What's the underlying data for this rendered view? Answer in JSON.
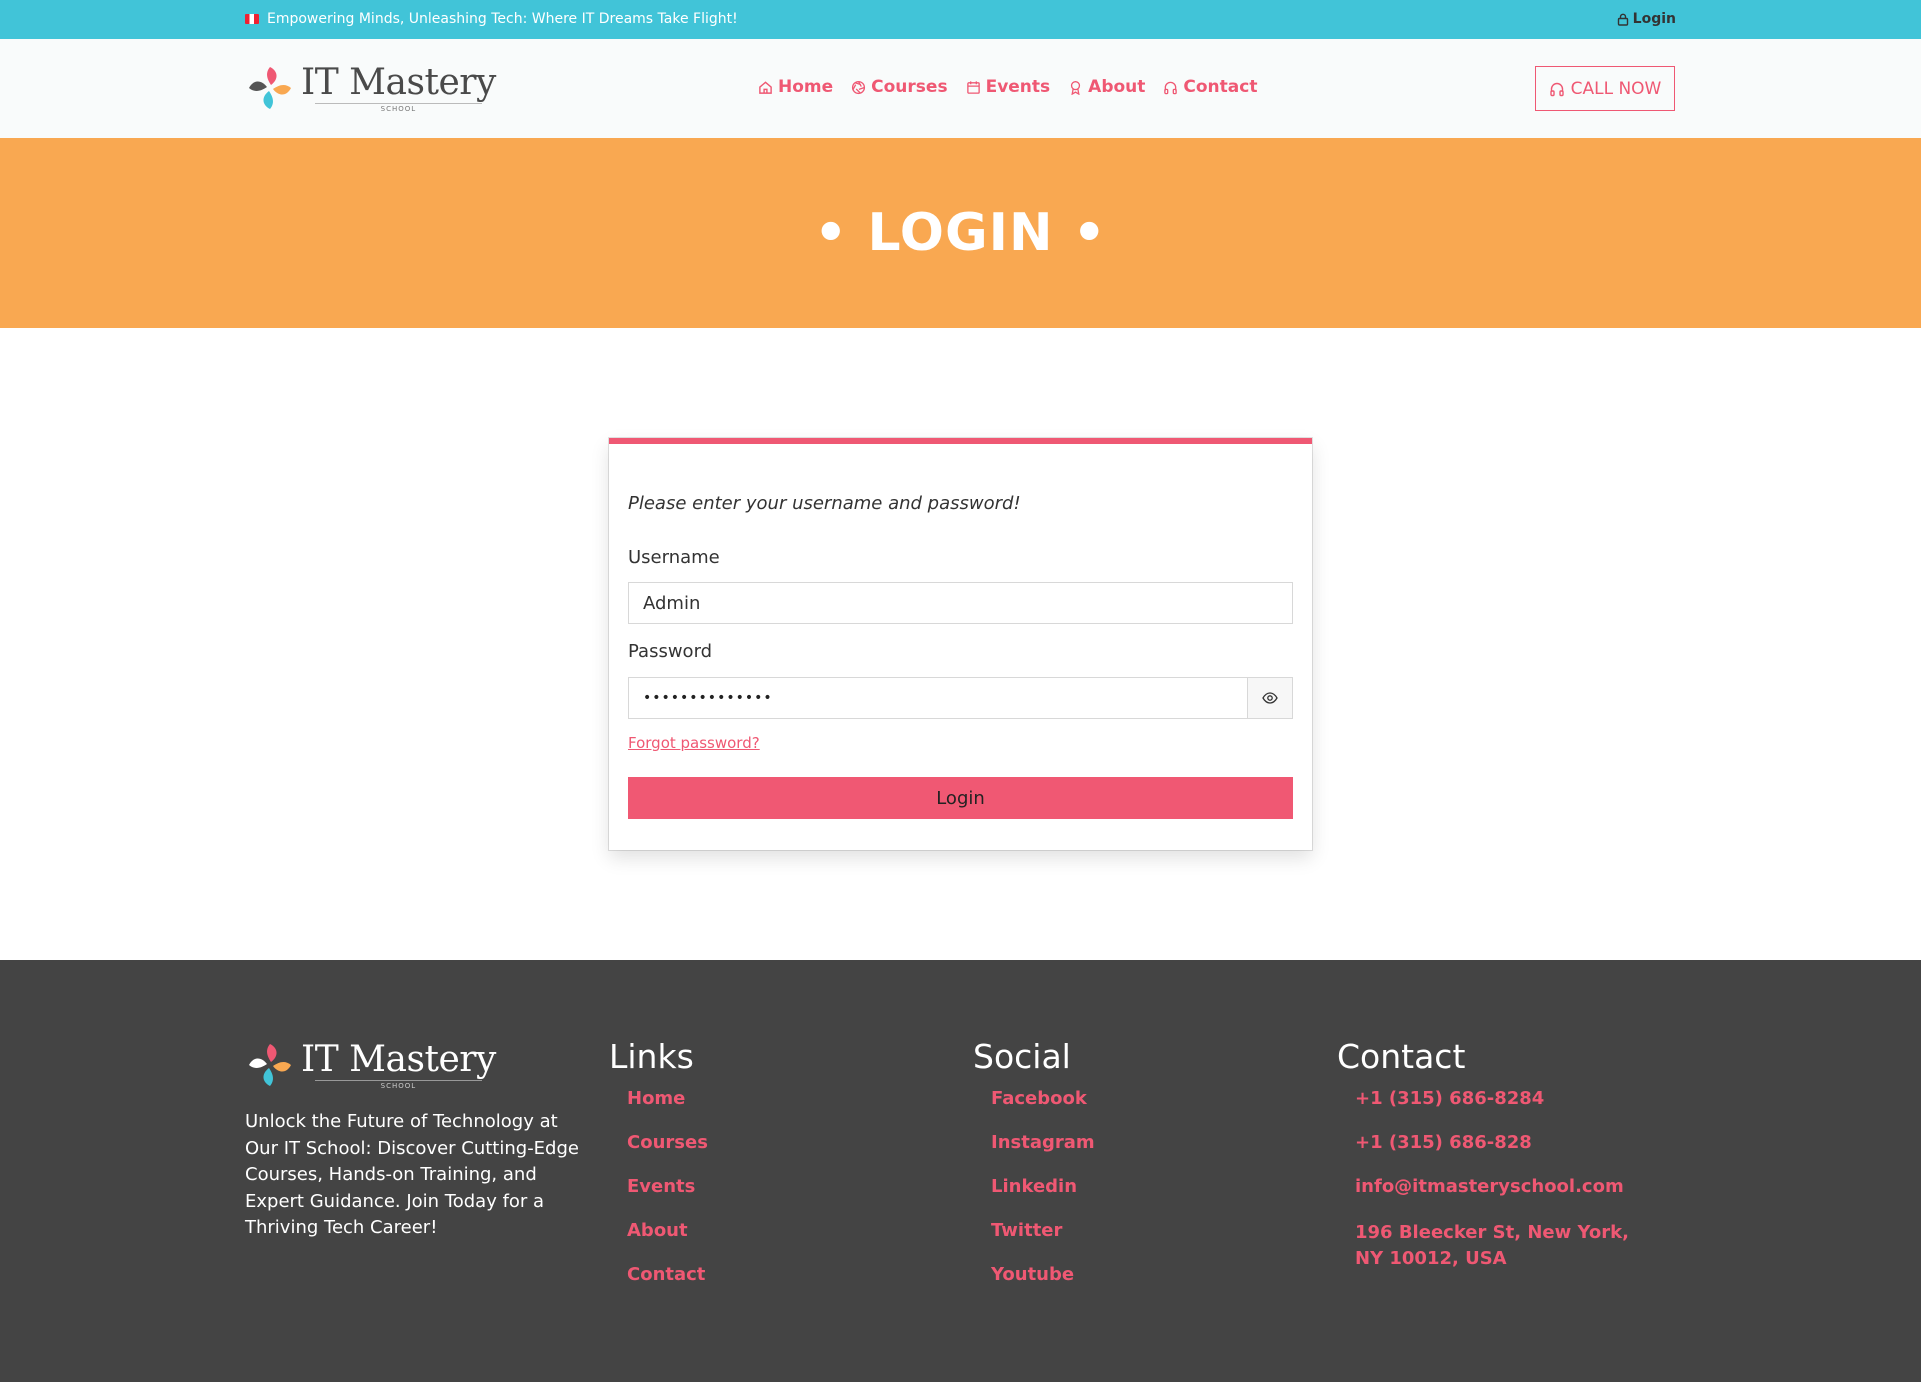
{
  "topbar": {
    "tagline": "Empowering Minds, Unleashing Tech: Where IT Dreams Take Flight!",
    "login": "Login"
  },
  "brand": {
    "name": "IT Mastery",
    "sub": "SCHOOL"
  },
  "nav": {
    "items": [
      {
        "label": "Home",
        "icon": "home-icon"
      },
      {
        "label": "Courses",
        "icon": "aperture-icon"
      },
      {
        "label": "Events",
        "icon": "calendar-icon"
      },
      {
        "label": "About",
        "icon": "award-icon"
      },
      {
        "label": "Contact",
        "icon": "headphones-icon"
      }
    ],
    "call_now": "CALL NOW"
  },
  "banner": {
    "title": "• LOGIN •"
  },
  "login_form": {
    "prompt": "Please enter your username and password!",
    "username_label": "Username",
    "username_value": "Admin",
    "password_label": "Password",
    "password_masked": "••••••••••••••",
    "forgot": "Forgot password?",
    "submit": "Login"
  },
  "footer": {
    "about": "Unlock the Future of Technology at Our IT School: Discover Cutting-Edge Courses, Hands-on Training, and Expert Guidance. Join Today for a Thriving Tech Career!",
    "links_heading": "Links",
    "links": [
      "Home",
      "Courses",
      "Events",
      "About",
      "Contact"
    ],
    "social_heading": "Social",
    "social": [
      "Facebook",
      "Instagram",
      "Linkedin",
      "Twitter",
      "Youtube"
    ],
    "contact_heading": "Contact",
    "contact": [
      "+1 (315) 686-8284",
      "+1 (315) 686-828",
      "info@itmasteryschool.com",
      "196 Bleecker St, New York, NY 10012, USA"
    ]
  },
  "colors": {
    "topbar": "#41c4d8",
    "accent": "#ef5873",
    "banner": "#f9a851",
    "footer": "#444444"
  }
}
